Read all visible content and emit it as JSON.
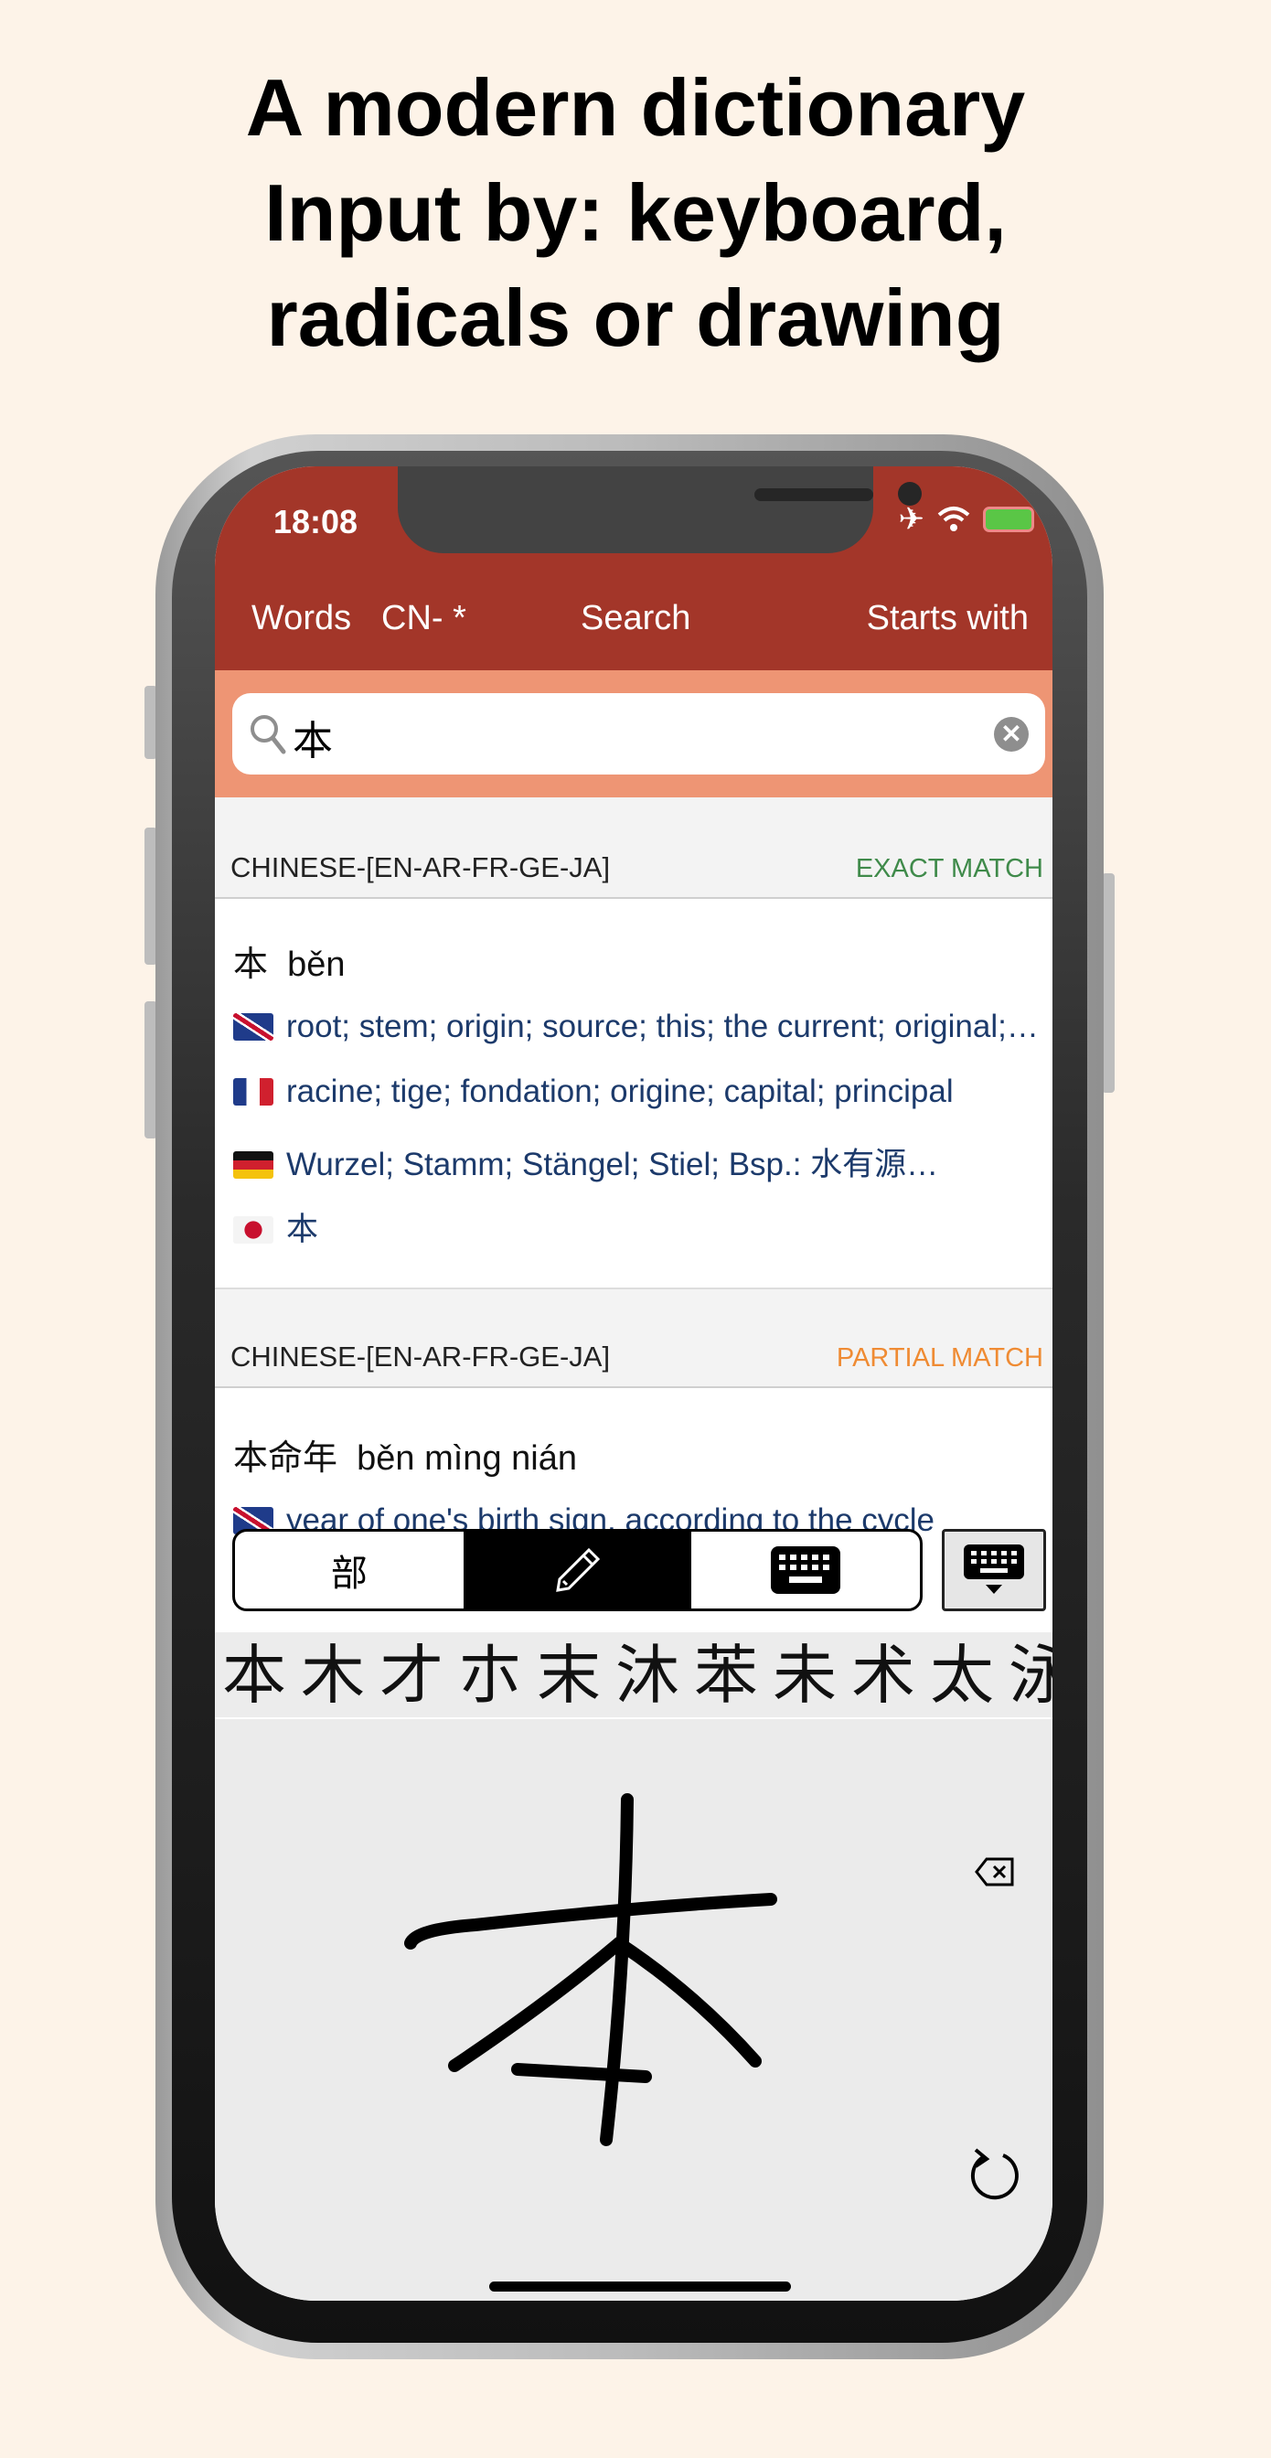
{
  "headline": [
    "A modern dictionary",
    "Input by: keyboard,",
    "radicals or drawing"
  ],
  "status": {
    "time": "18:08"
  },
  "nav": {
    "words": "Words",
    "lang": "CN- *",
    "title": "Search",
    "mode": "Starts with"
  },
  "search": {
    "value": "本"
  },
  "colors": {
    "nav": "#a33629",
    "search_band": "#ee9574",
    "exact": "#3f8a4a",
    "partial": "#ef8b33",
    "definition": "#1c3a6b"
  },
  "sections": [
    {
      "dict": "CHINESE-[EN-AR-FR-GE-JA]",
      "match": "EXACT MATCH",
      "entry": {
        "hanzi": "本",
        "pinyin": "běn",
        "defs": [
          {
            "flag": "uk",
            "text": "root; stem; origin; source; this; the current; original; inherent"
          },
          {
            "flag": "fr",
            "text": "racine; tige; fondation; origine; capital; principal"
          },
          {
            "flag": "de",
            "text": "Wurzel; Stamm; Stängel; Stiel; Bsp.: 水有源…"
          },
          {
            "flag": "jp",
            "text": "本"
          }
        ]
      }
    },
    {
      "dict": "CHINESE-[EN-AR-FR-GE-JA]",
      "match": "PARTIAL MATCH",
      "entry": {
        "hanzi": "本命年",
        "pinyin": "běn mìng nián",
        "defs": [
          {
            "flag": "uk",
            "text": "year of one's birth sign, according to the cycle"
          }
        ]
      }
    }
  ],
  "input": {
    "modes": [
      {
        "label": "部",
        "icon": "radical"
      },
      {
        "icon": "pencil-icon",
        "selected": true
      },
      {
        "icon": "keyboard-icon"
      }
    ],
    "candidates": [
      "本",
      "木",
      "才",
      "朩",
      "末",
      "沐",
      "苯",
      "未",
      "术",
      "太",
      "泳"
    ]
  }
}
